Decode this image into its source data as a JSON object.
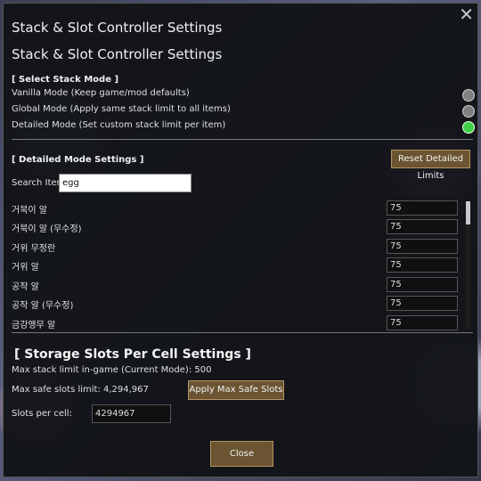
{
  "window": {
    "title": "Stack & Slot Controller Settings",
    "close_glyph": "✕"
  },
  "page_title": "Stack & Slot Controller Settings",
  "stack_mode": {
    "section_label": "[ Select Stack Mode ]",
    "options": [
      {
        "label": "Vanilla Mode (Keep game/mod defaults)",
        "selected": false
      },
      {
        "label": "Global Mode (Apply same stack limit to all items)",
        "selected": false
      },
      {
        "label": "Detailed Mode (Set custom stack limit per item)",
        "selected": true
      }
    ]
  },
  "detailed": {
    "section_label": "[ Detailed Mode Settings ]",
    "reset_button": "Reset Detailed Limits",
    "search_label": "Search Item:",
    "search_value": "egg",
    "items": [
      {
        "name": "거북이 알",
        "value": "75"
      },
      {
        "name": "거북이 알 (무수정)",
        "value": "75"
      },
      {
        "name": "거위 무정란",
        "value": "75"
      },
      {
        "name": "거위 알",
        "value": "75"
      },
      {
        "name": "공작 알",
        "value": "75"
      },
      {
        "name": "공작 알 (무수정)",
        "value": "75"
      },
      {
        "name": "금강앵무 알",
        "value": "75"
      }
    ]
  },
  "storage": {
    "title": "[ Storage Slots Per Cell Settings ]",
    "max_stack_text": "Max stack limit in-game (Current Mode): 500",
    "max_safe_text": "Max safe slots limit: 4,294,967",
    "apply_button": "Apply Max Safe Slots",
    "slots_label": "Slots per cell:",
    "slots_value": "4294967"
  },
  "close_button": "Close",
  "colors": {
    "button_bg": "#6b5432",
    "button_border": "#b49464",
    "radio_selected": "#3fd04a",
    "panel_bg": "#121418"
  }
}
